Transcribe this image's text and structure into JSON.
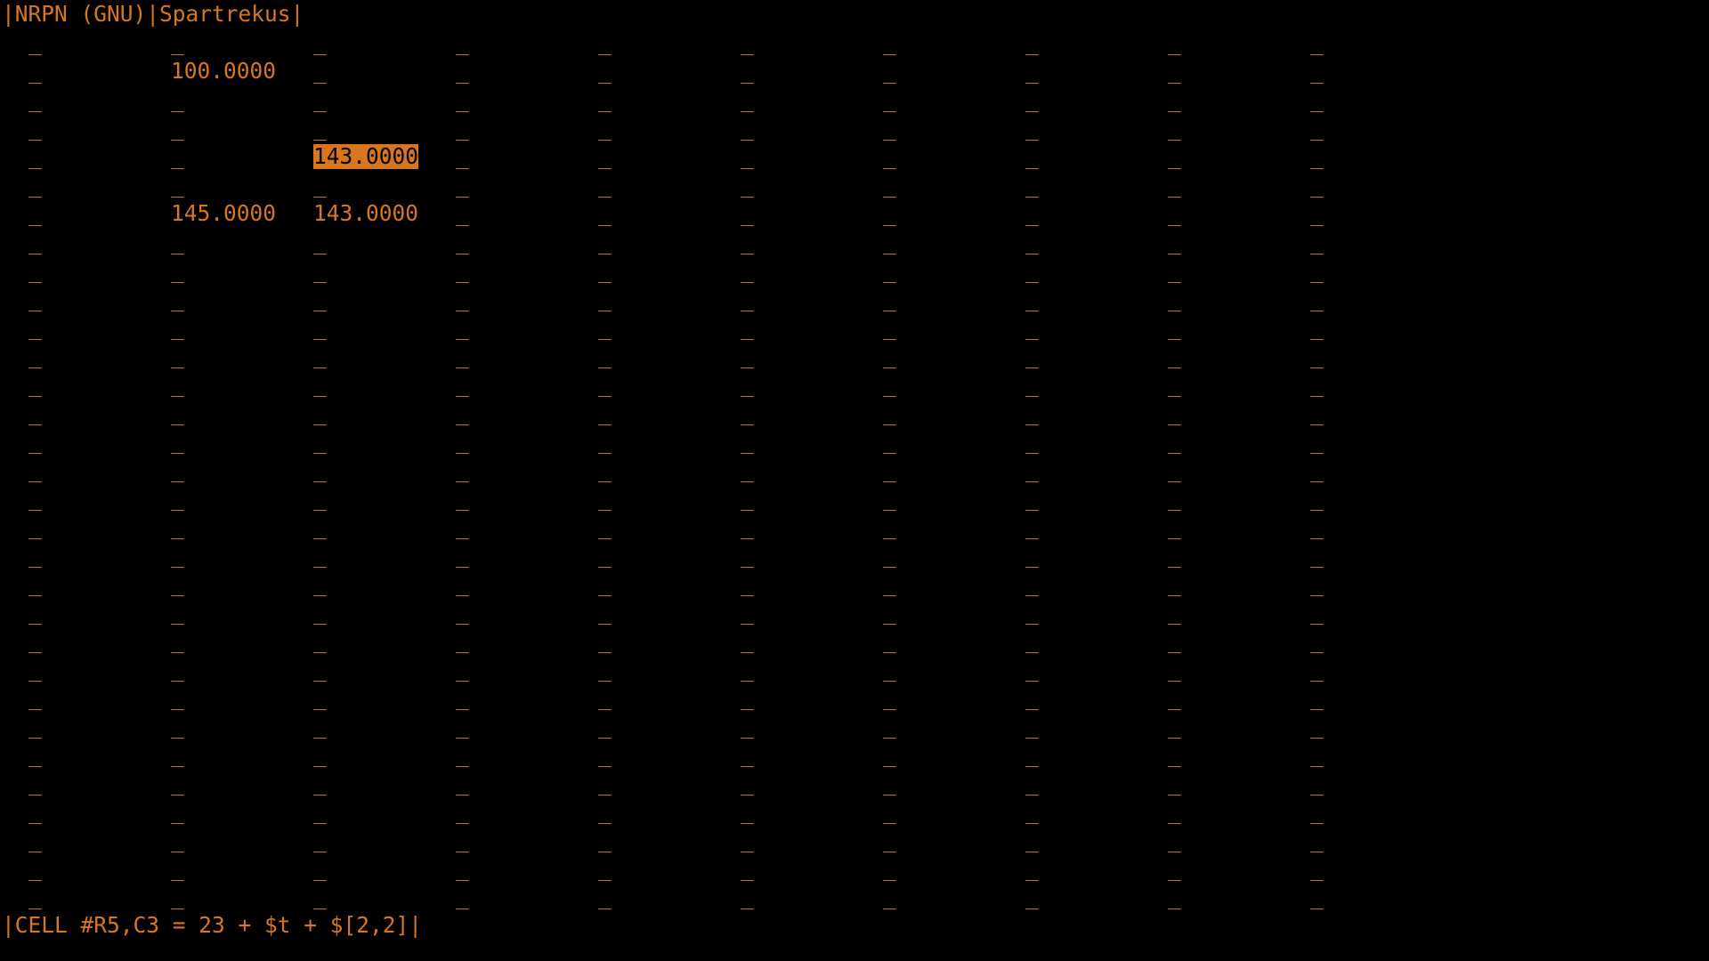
{
  "app": {
    "title": "|NRPN (GNU)|Spartrekus|",
    "colors": {
      "foreground": "#d9761d",
      "background": "#000000",
      "cursor_text": "#000000"
    }
  },
  "sheet": {
    "empty_marker": "_",
    "row_count": 31,
    "col_count": 10,
    "cells": [
      {
        "row": 2,
        "col": 2,
        "value": "100.0000"
      },
      {
        "row": 5,
        "col": 3,
        "value": "143.0000",
        "selected": true
      },
      {
        "row": 7,
        "col": 2,
        "value": "145.0000"
      },
      {
        "row": 7,
        "col": 3,
        "value": "143.0000"
      }
    ]
  },
  "statusbar": {
    "text": "|CELL #R5,C3 = 23 + $t + $[2,2]|"
  }
}
